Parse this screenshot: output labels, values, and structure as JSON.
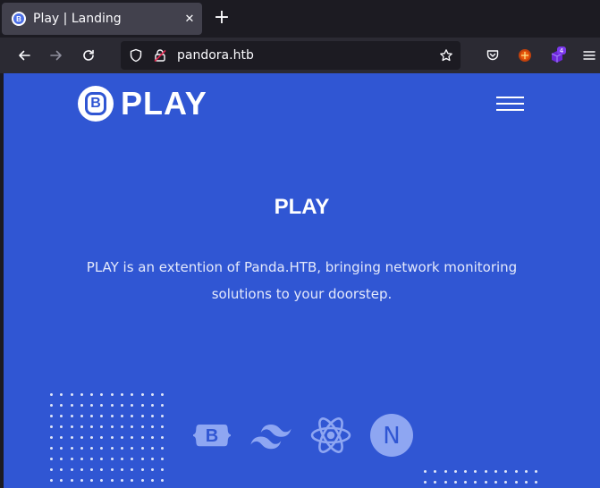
{
  "browser": {
    "tab": {
      "title": "Play | Landing",
      "favicon_letter": "B"
    },
    "new_tab_label": "+",
    "url": "pandora.htb",
    "extension_badge": "4"
  },
  "site": {
    "logo_letter": "B",
    "logo_text": "PLAY",
    "hero_title": "PLAY",
    "hero_description": "PLAY is an extention of Panda.HTB, bringing network monitoring solutions to your doorstep.",
    "brand_icons": [
      "bootstrap-icon",
      "tailwind-icon",
      "react-icon",
      "nextjs-icon"
    ],
    "bootstrap_letter": "B",
    "next_letter": "N"
  },
  "colors": {
    "page_bg": "#3056d3",
    "brand_icon": "#8ea6f2",
    "toolbar_bg": "#2b2a33",
    "tabstrip_bg": "#1c1b22"
  }
}
